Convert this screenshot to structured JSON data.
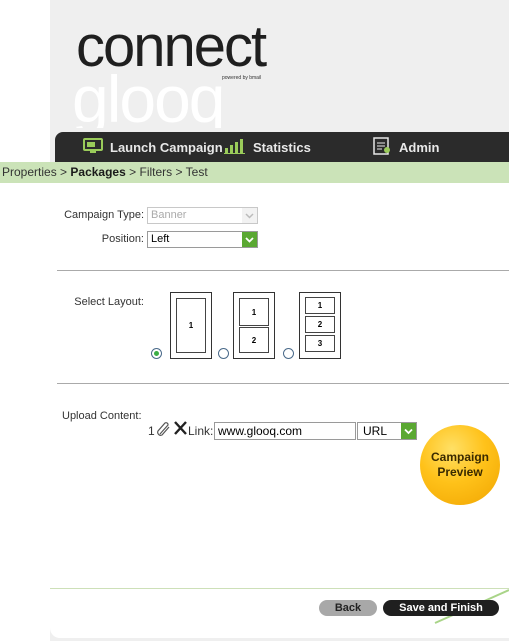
{
  "logo": {
    "word_top": "connect",
    "word_bottom": "glooq",
    "tagline": "powered by bmail"
  },
  "nav": {
    "items": [
      {
        "label": "Launch Campaign",
        "icon": "monitor-icon"
      },
      {
        "label": "Statistics",
        "icon": "bar-chart-icon"
      },
      {
        "label": "Admin",
        "icon": "admin-document-icon"
      }
    ]
  },
  "breadcrumb": {
    "items": [
      "Properties",
      "Packages",
      "Filters",
      "Test"
    ],
    "separator": ">",
    "active": "Packages"
  },
  "form": {
    "campaign_type_label": "Campaign Type:",
    "campaign_type_value": "Banner",
    "position_label": "Position:",
    "position_value": "Left",
    "select_layout_label": "Select Layout:",
    "layouts": [
      {
        "cells": [
          "1"
        ],
        "selected": true
      },
      {
        "cells": [
          "1",
          "2"
        ],
        "selected": false
      },
      {
        "cells": [
          "1",
          "2",
          "3"
        ],
        "selected": false
      }
    ],
    "upload_label": "Upload Content:",
    "row_number": "1",
    "link_label": "Link:",
    "link_value": "www.glooq.com",
    "link_type_value": "URL"
  },
  "preview_label_line1": "Campaign",
  "preview_label_line2": "Preview",
  "buttons": {
    "back": "Back",
    "save": "Save and Finish"
  },
  "colors": {
    "nav_bg": "#2b2b2b",
    "breadcrumb_bg": "#cbe3b8",
    "accent_green": "#5aa832",
    "preview_orange": "#ffc21a"
  }
}
